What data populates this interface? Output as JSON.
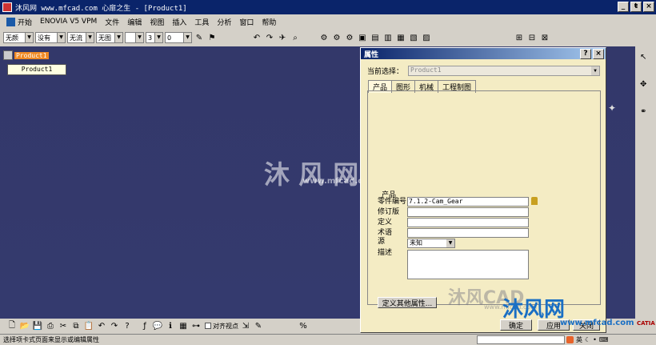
{
  "window": {
    "title": "沐风网 www.mfcad.com 心扉之生 - [Product1]",
    "min_label": "_",
    "restore_label": "ŧ",
    "close_label": "×"
  },
  "menubar": {
    "items": [
      "开始",
      "ENOVIA V5 VPM",
      "文件",
      "编辑",
      "视图",
      "插入",
      "工具",
      "分析",
      "窗口",
      "帮助"
    ]
  },
  "toolbar": {
    "combos": [
      "无颜",
      "没有",
      "无流",
      "无图",
      "",
      "3"
    ],
    "extra_combo": "0"
  },
  "tree": {
    "root_label": "Product1",
    "tooltip": "Product1"
  },
  "watermark": {
    "center_text": "沐 风 网",
    "center_url": "www.mfcad.com",
    "dialog_text": "沐风CAD",
    "dialog_url": "www.mfcad.com",
    "corner_text": "沐风网",
    "corner_url": "www.mfcad.com"
  },
  "dialog": {
    "title": "属性",
    "help_label": "?",
    "close_label": "×",
    "current_selection_label": "当前选择：",
    "current_selection_value": "Product1",
    "tabs": [
      "产品",
      "图形",
      "机械",
      "工程制图"
    ],
    "group_label": "产品",
    "fields": {
      "part_number_label": "零件编号",
      "part_number_value": "7.1.2-Cam_Gear",
      "revision_label": "修订版",
      "revision_value": "",
      "definition_label": "定义",
      "definition_value": "",
      "nomenclature_label": "术语",
      "nomenclature_value": "",
      "source_label": "源",
      "source_value": "未知",
      "description_label": "描述",
      "description_value": ""
    },
    "more_button": "定义其他属性...",
    "ok_button": "确定",
    "apply_button": "应用",
    "close_button": "关闭"
  },
  "bottom_toolbar": {
    "snap_label": "对齐视点"
  },
  "statusbar": {
    "text": "选择项卡式页面来显示或编辑属性",
    "ime_label": "英"
  },
  "axis": {
    "catia_label": "CATIA"
  }
}
